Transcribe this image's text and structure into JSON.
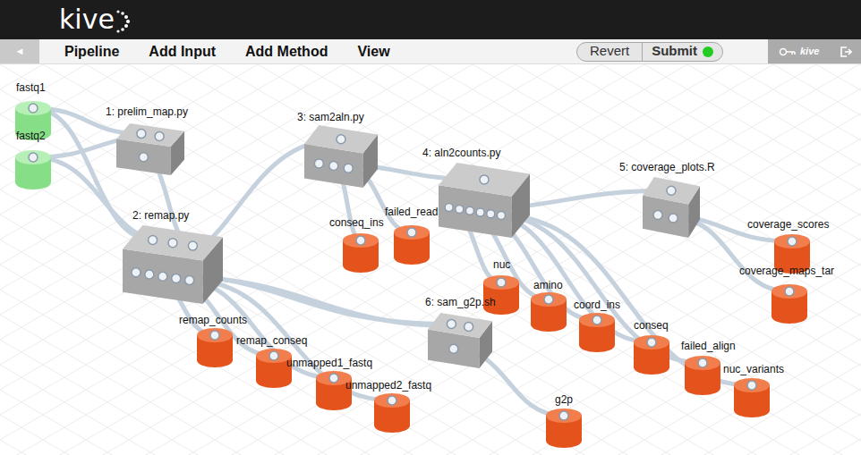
{
  "logo": "kive",
  "menu": {
    "back": "◄",
    "items": [
      "Pipeline",
      "Add Input",
      "Add Method",
      "View"
    ],
    "revert": "Revert",
    "submit": {
      "label": "Submit",
      "ready": true
    }
  },
  "user": "kive",
  "canvas": {
    "nodes": [
      {
        "label": "fastq1",
        "kind": "input"
      },
      {
        "label": "fastq2",
        "kind": "input"
      },
      {
        "label": "1: prelim_map.py",
        "kind": "method",
        "inputs": 2,
        "outputs": 1
      },
      {
        "label": "2: remap.py",
        "kind": "method",
        "inputs": 3,
        "outputs": 5
      },
      {
        "label": "3: sam2aln.py",
        "kind": "method",
        "inputs": 1,
        "outputs": 3
      },
      {
        "label": "4: aln2counts.py",
        "kind": "method",
        "inputs": 1,
        "outputs": 6
      },
      {
        "label": "5: coverage_plots.R",
        "kind": "method",
        "inputs": 1,
        "outputs": 2
      },
      {
        "label": "6: sam_g2p.sh",
        "kind": "method",
        "inputs": 2,
        "outputs": 1
      },
      {
        "label": "conseq_ins",
        "kind": "output"
      },
      {
        "label": "failed_read",
        "kind": "output"
      },
      {
        "label": "remap_counts",
        "kind": "output"
      },
      {
        "label": "remap_conseq",
        "kind": "output"
      },
      {
        "label": "unmapped1_fastq",
        "kind": "output"
      },
      {
        "label": "unmapped2_fastq",
        "kind": "output"
      },
      {
        "label": "nuc",
        "kind": "output"
      },
      {
        "label": "amino",
        "kind": "output"
      },
      {
        "label": "coord_ins",
        "kind": "output"
      },
      {
        "label": "conseq",
        "kind": "output"
      },
      {
        "label": "failed_align",
        "kind": "output"
      },
      {
        "label": "nuc_variants",
        "kind": "output"
      },
      {
        "label": "coverage_scores",
        "kind": "output"
      },
      {
        "label": "coverage_maps_tar",
        "kind": "output"
      },
      {
        "label": "g2p",
        "kind": "output"
      }
    ],
    "links": [
      {
        "from": "fastq1",
        "to": "1: prelim_map.py",
        "in": 0
      },
      {
        "from": "fastq2",
        "to": "1: prelim_map.py",
        "in": 1
      },
      {
        "from": "fastq1",
        "to": "2: remap.py",
        "in": 0
      },
      {
        "from": "fastq2",
        "to": "2: remap.py",
        "in": 1
      },
      {
        "from": "1: prelim_map.py",
        "out": 0,
        "to": "2: remap.py",
        "in": 2
      },
      {
        "from": "2: remap.py",
        "out": 0,
        "to": "3: sam2aln.py",
        "in": 0
      },
      {
        "from": "2: remap.py",
        "out": 0,
        "to": "6: sam_g2p.sh",
        "in": 0
      },
      {
        "from": "2: remap.py",
        "out": 1,
        "to": "remap_counts"
      },
      {
        "from": "2: remap.py",
        "out": 2,
        "to": "remap_conseq"
      },
      {
        "from": "2: remap.py",
        "out": 2,
        "to": "6: sam_g2p.sh",
        "in": 1
      },
      {
        "from": "2: remap.py",
        "out": 3,
        "to": "unmapped1_fastq"
      },
      {
        "from": "2: remap.py",
        "out": 4,
        "to": "unmapped2_fastq"
      },
      {
        "from": "3: sam2aln.py",
        "out": 0,
        "to": "4: aln2counts.py",
        "in": 0
      },
      {
        "from": "3: sam2aln.py",
        "out": 1,
        "to": "conseq_ins"
      },
      {
        "from": "3: sam2aln.py",
        "out": 2,
        "to": "failed_read"
      },
      {
        "from": "4: aln2counts.py",
        "out": 0,
        "to": "nuc"
      },
      {
        "from": "4: aln2counts.py",
        "out": 1,
        "to": "amino"
      },
      {
        "from": "4: aln2counts.py",
        "out": 2,
        "to": "coord_ins"
      },
      {
        "from": "4: aln2counts.py",
        "out": 3,
        "to": "conseq"
      },
      {
        "from": "4: aln2counts.py",
        "out": 4,
        "to": "failed_align"
      },
      {
        "from": "4: aln2counts.py",
        "out": 5,
        "to": "nuc_variants"
      },
      {
        "from": "4: aln2counts.py",
        "out": 1,
        "to": "5: coverage_plots.R",
        "in": 0
      },
      {
        "from": "5: coverage_plots.R",
        "out": 0,
        "to": "coverage_scores"
      },
      {
        "from": "5: coverage_plots.R",
        "out": 1,
        "to": "coverage_maps_tar"
      },
      {
        "from": "6: sam_g2p.sh",
        "out": 0,
        "to": "g2p"
      }
    ]
  }
}
